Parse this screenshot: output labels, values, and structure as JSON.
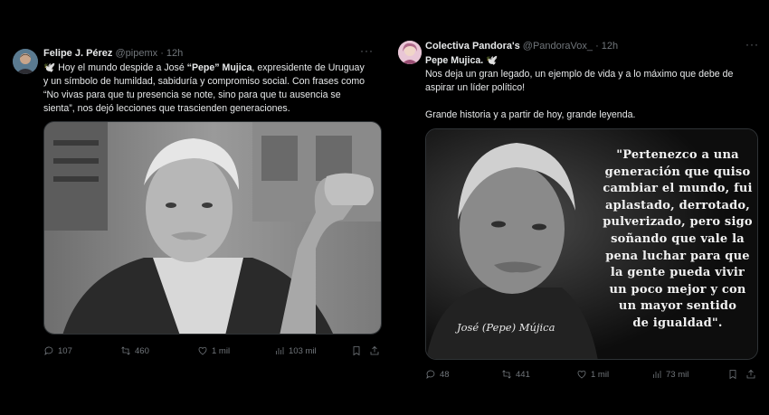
{
  "tweets": [
    {
      "author": "Felipe J. Pérez",
      "handle": "@pipemx",
      "time": "· 12h",
      "line1_pre": "🕊️ Hoy el mundo despide a José ",
      "line1_bold": "“Pepe” Mujica",
      "line1_post": ", expresidente de Uruguay",
      "line2": "y un símbolo de humildad, sabiduría y compromiso social. Con frases como",
      "line3": "“No vivas para que tu presencia se note, sino para que tu ausencia se",
      "line4": "sienta”, nos dejó lecciones que trascienden generaciones.",
      "replies": "107",
      "reposts": "460",
      "likes": "1 mil",
      "views": "103 mil"
    },
    {
      "author": "Colectiva Pandora's",
      "handle": "@PandoraVox_",
      "time": "· 12h",
      "title": "Pepe Mujica. 🕊️",
      "line1": "Nos deja un gran legado, un ejemplo de vida y a lo máximo que debe de",
      "line2": "aspirar un líder político!",
      "line3": "Grande historia y a partir de hoy, grande leyenda.",
      "quote": [
        "\"Pertenezco a una",
        "generación que quiso",
        "cambiar el mundo, fui",
        "aplastado, derrotado,",
        "pulverizado, pero sigo",
        "soñando que vale la",
        "pena luchar para que",
        "la gente pueda vivir",
        "un poco mejor y con",
        "un mayor sentido",
        "de igualdad\"."
      ],
      "signature": "José (Pepe) Mújica",
      "replies": "48",
      "reposts": "441",
      "likes": "1 mil",
      "views": "73 mil"
    }
  ],
  "more_label": "···"
}
